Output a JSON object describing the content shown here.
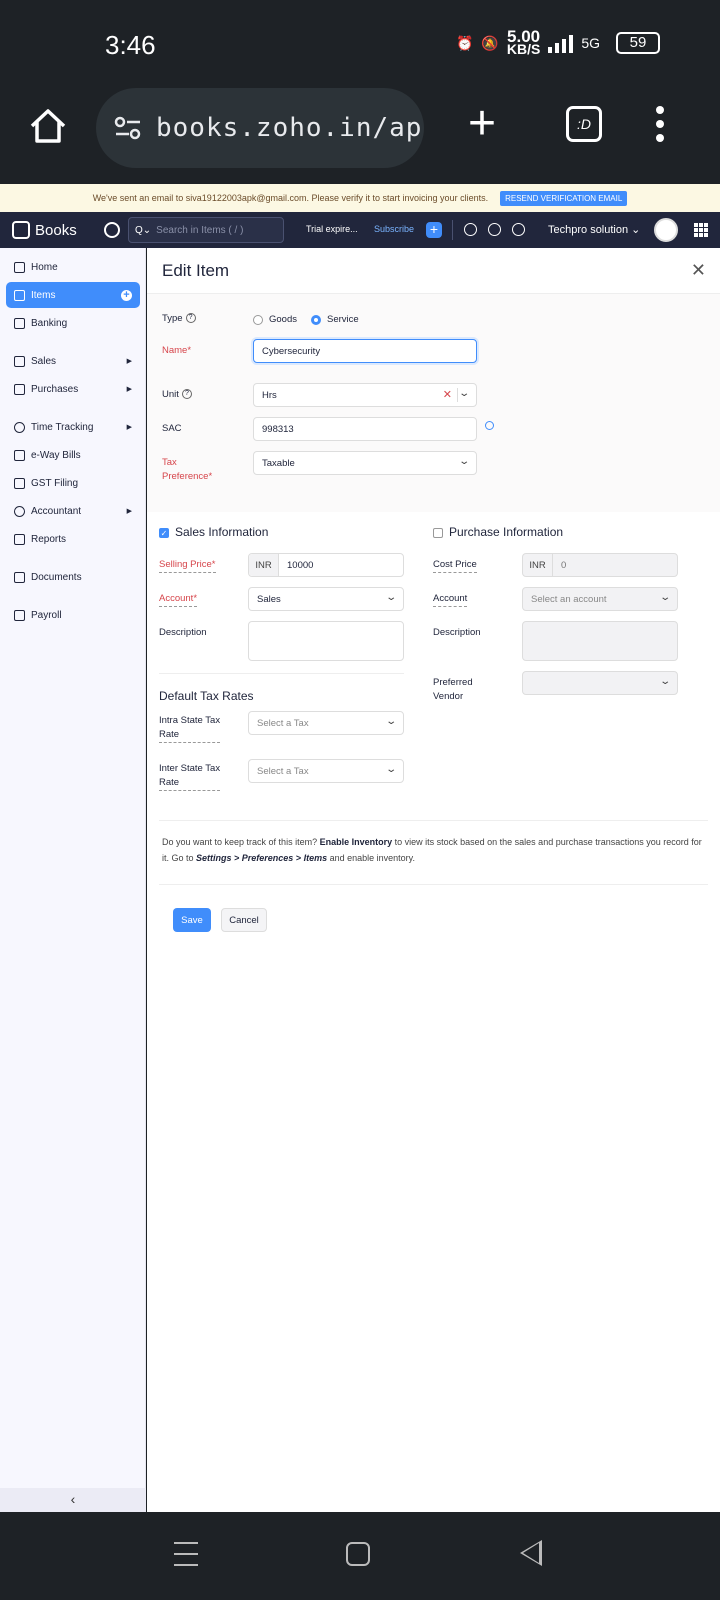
{
  "status_bar": {
    "time": "3:46",
    "net_speed": "5.00",
    "net_unit": "KB/S",
    "net_type": "5G",
    "battery": "59"
  },
  "browser": {
    "url": "books.zoho.in/ap"
  },
  "banner": {
    "message": "We've sent an email to siva19122003apk@gmail.com. Please verify it to start invoicing your clients.",
    "button": "RESEND VERIFICATION EMAIL"
  },
  "header": {
    "app_name": "Books",
    "search_placeholder": "Search in Items ( / )",
    "trial": "Trial expire...",
    "subscribe": "Subscribe",
    "org": "Techpro solution"
  },
  "sidebar": {
    "items": [
      {
        "label": "Home"
      },
      {
        "label": "Items"
      },
      {
        "label": "Banking"
      },
      {
        "label": "Sales"
      },
      {
        "label": "Purchases"
      },
      {
        "label": "Time Tracking"
      },
      {
        "label": "e-Way Bills"
      },
      {
        "label": "GST Filing"
      },
      {
        "label": "Accountant"
      },
      {
        "label": "Reports"
      },
      {
        "label": "Documents"
      },
      {
        "label": "Payroll"
      }
    ]
  },
  "form": {
    "title": "Edit Item",
    "type_label": "Type",
    "type_goods": "Goods",
    "type_service": "Service",
    "name_label": "Name*",
    "name_value": "Cybersecurity",
    "unit_label": "Unit",
    "unit_value": "Hrs",
    "sac_label": "SAC",
    "sac_value": "998313",
    "tax_pref_label_1": "Tax",
    "tax_pref_label_2": "Preference*",
    "tax_pref_value": "Taxable",
    "sales_heading": "Sales Information",
    "purchase_heading": "Purchase Information",
    "selling_price_label": "Selling Price*",
    "currency": "INR",
    "selling_price_value": "10000",
    "sales_account_label": "Account*",
    "sales_account_value": "Sales",
    "sales_desc_label": "Description",
    "cost_price_label": "Cost Price",
    "cost_price_value": "0",
    "purchase_account_label": "Account",
    "purchase_account_placeholder": "Select an account",
    "purchase_desc_label": "Description",
    "pref_vendor_label_1": "Preferred",
    "pref_vendor_label_2": "Vendor",
    "tax_rates_heading": "Default Tax Rates",
    "intra_label_1": "Intra State Tax",
    "intra_label_2": "Rate",
    "inter_label_1": "Inter State Tax",
    "inter_label_2": "Rate",
    "tax_placeholder": "Select a Tax",
    "note_1": "Do you want to keep track of this item? ",
    "note_bold": "Enable Inventory",
    "note_2": " to view its stock based on the sales and purchase transactions you record for it. Go to ",
    "note_path": "Settings > Preferences > Items",
    "note_3": " and enable inventory.",
    "save": "Save",
    "cancel": "Cancel"
  },
  "colors": {
    "accent": "#408dfb",
    "header_bg": "#21263c",
    "required": "#d6454b"
  }
}
